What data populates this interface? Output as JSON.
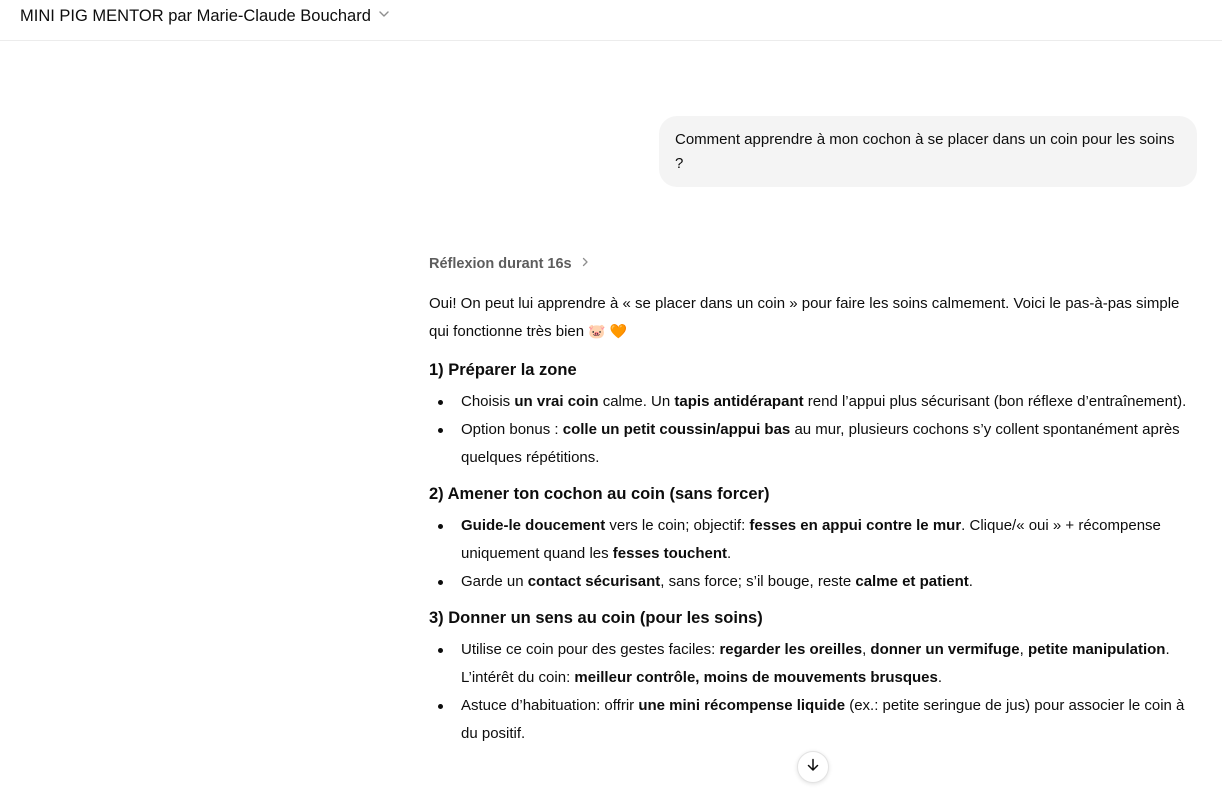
{
  "header": {
    "title": "MINI PIG MENTOR par Marie-Claude Bouchard",
    "title_menu_icon": "chevron-down-icon"
  },
  "user_message": "Comment apprendre à mon cochon à se placer dans un coin pour les soins ?",
  "assistant": {
    "thought_label": "Réflexion durant 16s",
    "thought_icon": "chevron-right-icon",
    "intro": "Oui! On peut lui apprendre à « se placer dans un coin » pour faire les soins calmement. Voici le pas-à-pas simple qui fonctionne très bien",
    "intro_emojis": [
      "🐷",
      "🧡"
    ],
    "sections": [
      {
        "heading": "1) Préparer la zone",
        "items": [
          [
            "Choisis ",
            "un vrai coin",
            " calme. Un ",
            "tapis antidérapant",
            " rend l’appui plus sécurisant (bon réflexe d’entraînement)."
          ],
          [
            "Option bonus : ",
            "colle un petit coussin/appui bas",
            " au mur, plusieurs cochons s’y collent spontanément après quelques répétitions."
          ]
        ]
      },
      {
        "heading": "2) Amener ton cochon au coin (sans forcer)",
        "items": [
          [
            "",
            "Guide-le doucement",
            " vers le coin; objectif: ",
            "fesses en appui contre le mur",
            ". Clique/« oui » + récompense uniquement quand les ",
            "fesses touchent",
            "."
          ],
          [
            "Garde un ",
            "contact sécurisant",
            ", sans force; s’il bouge, reste ",
            "calme et patient",
            "."
          ]
        ]
      },
      {
        "heading": "3) Donner un sens au coin (pour les soins)",
        "items": [
          [
            "Utilise ce coin pour des gestes faciles: ",
            "regarder les oreilles",
            ", ",
            "donner un vermifuge",
            ", ",
            "petite manipulation",
            ". L’intérêt du coin: ",
            "meilleur contrôle, moins de mouvements brusques",
            "."
          ],
          [
            "Astuce d’habituation: offrir ",
            "une mini récompense liquide",
            " (ex.: petite seringue de jus) pour associer le coin à du positif."
          ]
        ]
      }
    ]
  },
  "scroll_button_icon": "arrow-down-icon"
}
